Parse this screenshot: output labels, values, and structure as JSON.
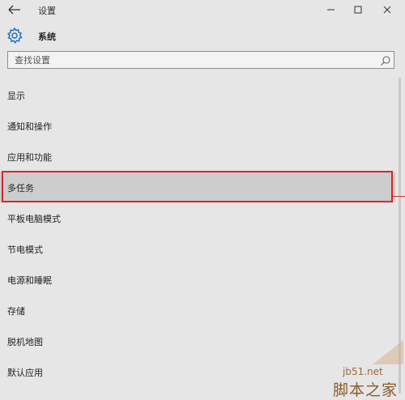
{
  "window": {
    "title": "设置",
    "controls": {
      "minimize": "minimize",
      "maximize": "maximize",
      "close": "close"
    }
  },
  "header": {
    "title": "系统",
    "icon": "gear-icon"
  },
  "search": {
    "placeholder": "查找设置",
    "value": ""
  },
  "menu": {
    "items": [
      {
        "label": "显示"
      },
      {
        "label": "通知和操作"
      },
      {
        "label": "应用和功能"
      },
      {
        "label": "多任务",
        "selected": true
      },
      {
        "label": "平板电脑模式"
      },
      {
        "label": "节电模式"
      },
      {
        "label": "电源和睡眠"
      },
      {
        "label": "存储"
      },
      {
        "label": "脱机地图"
      },
      {
        "label": "默认应用"
      }
    ]
  },
  "watermark": {
    "site": "jb51.net",
    "name": "脚本之家"
  },
  "colors": {
    "accent": "#1b6ac9",
    "background": "#e6e6e6",
    "selected": "#cdcdcd",
    "annotation": "#d9262b",
    "watermark": "#8b5a2b"
  }
}
